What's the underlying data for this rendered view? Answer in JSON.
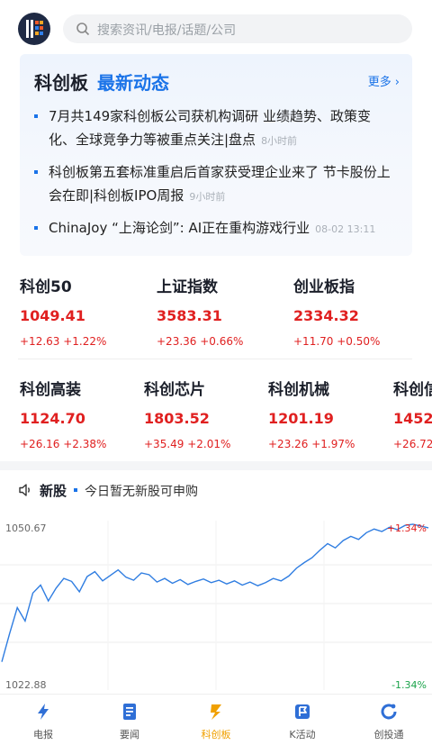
{
  "search": {
    "placeholder": "搜索资讯/电报/话题/公司"
  },
  "news": {
    "title_main": "科创板",
    "title_accent": "最新动态",
    "more_label": "更多",
    "items": [
      {
        "text": "7月共149家科创板公司获机构调研 业绩趋势、政策变化、全球竞争力等被重点关注|盘点",
        "time": "8小时前"
      },
      {
        "text": "科创板第五套标准重启后首家获受理企业来了 节卡股份上会在即|科创板IPO周报",
        "time": "9小时前"
      },
      {
        "text": "ChinaJoy “上海论剑”: AI正在重构游戏行业",
        "time": "08-02 13:11"
      }
    ]
  },
  "indices_row1": [
    {
      "name": "科创50",
      "value": "1049.41",
      "change": "+12.63 +1.22%"
    },
    {
      "name": "上证指数",
      "value": "3583.31",
      "change": "+23.36 +0.66%"
    },
    {
      "name": "创业板指",
      "value": "2334.32",
      "change": "+11.70 +0.50%"
    }
  ],
  "indices_row2": [
    {
      "name": "科创高装",
      "value": "1124.70",
      "change": "+26.16 +2.38%"
    },
    {
      "name": "科创芯片",
      "value": "1803.52",
      "change": "+35.49 +2.01%"
    },
    {
      "name": "科创机械",
      "value": "1201.19",
      "change": "+23.26 +1.97%"
    },
    {
      "name": "科创信",
      "value": "1452.",
      "change": "+26.72"
    }
  ],
  "ipo": {
    "label": "新股",
    "message": "今日暂无新股可申购"
  },
  "chart": {
    "y_top": "1050.67",
    "y_bottom": "1022.88",
    "pct_top": "+1.34%",
    "pct_bottom": "-1.34%"
  },
  "chart_data": {
    "type": "line",
    "ylim": [
      1022.88,
      1050.67
    ],
    "values": [
      1027.5,
      1032.1,
      1036.4,
      1034.2,
      1038.8,
      1040.1,
      1037.5,
      1039.6,
      1041.2,
      1040.7,
      1039.0,
      1041.5,
      1042.3,
      1040.8,
      1041.7,
      1042.6,
      1041.4,
      1040.9,
      1042.1,
      1041.8,
      1040.6,
      1041.2,
      1040.4,
      1041.0,
      1040.2,
      1040.7,
      1041.1,
      1040.5,
      1040.9,
      1040.3,
      1040.8,
      1040.1,
      1040.6,
      1040.0,
      1040.5,
      1041.2,
      1040.8,
      1041.6,
      1042.9,
      1043.8,
      1044.6,
      1045.8,
      1046.9,
      1046.2,
      1047.4,
      1048.1,
      1047.6,
      1048.7,
      1049.3,
      1048.9,
      1049.6,
      1049.2,
      1049.9,
      1050.1,
      1049.8,
      1049.5
    ]
  },
  "colors": {
    "accent": "#1a73e8",
    "up": "#e02020",
    "down": "#1aa34a",
    "active_tab": "#f0a000"
  },
  "tabs": [
    {
      "label": "电报",
      "icon": "lightning-icon"
    },
    {
      "label": "要闻",
      "icon": "document-icon"
    },
    {
      "label": "科创板",
      "icon": "kechuang-icon"
    },
    {
      "label": "K活动",
      "icon": "flag-icon"
    },
    {
      "label": "创投通",
      "icon": "refresh-icon"
    }
  ]
}
